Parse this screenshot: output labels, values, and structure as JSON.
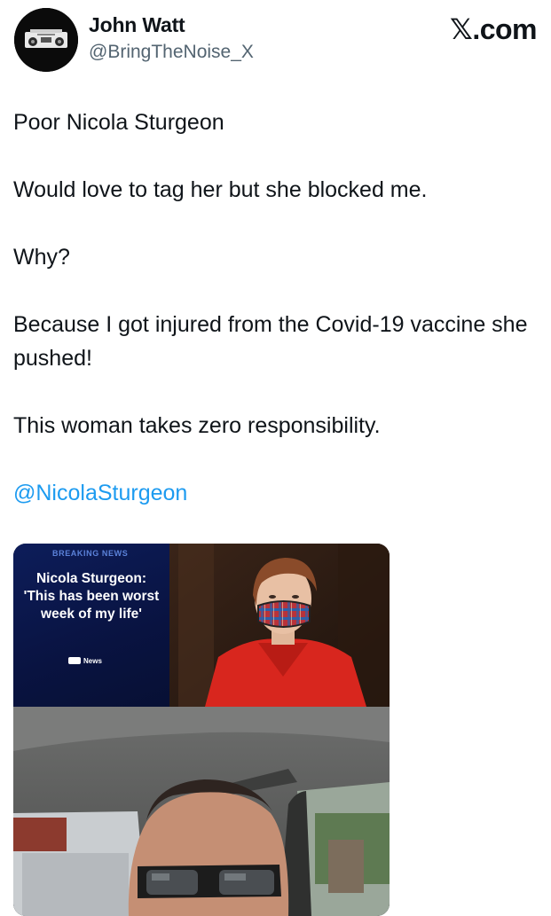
{
  "author": {
    "name": "John Watt",
    "handle": "@BringTheNoise_X",
    "avatar_icon": "boombox-avatar-icon"
  },
  "brand": {
    "glyph": "𝕏",
    "suffix": ".com"
  },
  "tweet": {
    "paragraphs": [
      "Poor Nicola Sturgeon",
      "Would love to tag her but she blocked me.",
      "Why?",
      "Because I got injured from the Covid-19 vaccine she pushed!",
      "This woman takes zero responsibility."
    ],
    "mention": "@NicolaSturgeon"
  },
  "media": {
    "news_card": {
      "badge": "BREAKING NEWS",
      "headline": "Nicola Sturgeon: 'This has been worst week of my life'",
      "source": "News"
    }
  },
  "colors": {
    "text": "#0f1419",
    "secondary": "#536471",
    "link": "#1d9bf0",
    "news_blue": "#0d1d5a",
    "jacket_red": "#d8261e"
  }
}
